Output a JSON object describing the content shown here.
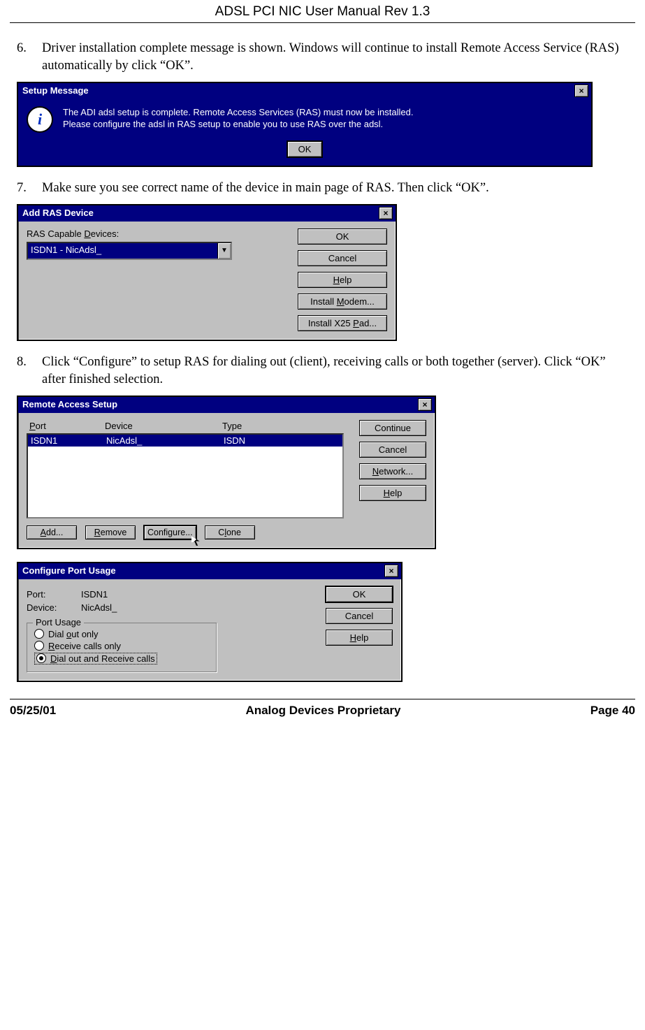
{
  "header": "ADSL PCI NIC User Manual Rev 1.3",
  "footer": {
    "date": "05/25/01",
    "center": "Analog Devices Proprietary",
    "page": "Page 40"
  },
  "steps": {
    "s6": {
      "num": "6.",
      "text": "Driver installation complete message is shown.  Windows will continue to install Remote Access Service (RAS) automatically by click “OK”."
    },
    "s7": {
      "num": "7.",
      "text": "Make sure you see correct name of the device in main page of RAS.  Then click “OK”."
    },
    "s8": {
      "num": "8.",
      "text": "Click “Configure” to setup RAS for dialing out (client), receiving calls or both together (server).  Click “OK” after finished selection."
    }
  },
  "dlg1": {
    "title": "Setup Message",
    "line1": "The ADI adsl setup is complete. Remote Access Services (RAS) must now be installed.",
    "line2": "Please configure the adsl in RAS setup to enable you to use RAS over the adsl.",
    "ok": "OK"
  },
  "dlg2": {
    "title": "Add RAS Device",
    "label": "RAS Capable Devices:",
    "label_underline": "D",
    "selected": "ISDN1 - NicAdsl_",
    "buttons": {
      "ok": "OK",
      "cancel": "Cancel",
      "help": "Help",
      "help_u": "H",
      "modem": "Install Modem...",
      "modem_u": "M",
      "x25": "Install X25 Pad...",
      "x25_u": "P"
    }
  },
  "dlg3": {
    "title": "Remote Access Setup",
    "cols": {
      "port": "Port",
      "port_u": "P",
      "device": "Device",
      "type": "Type"
    },
    "row": {
      "port": "ISDN1",
      "device": "NicAdsl_",
      "type": "ISDN"
    },
    "buttons": {
      "continue": "Continue",
      "cancel": "Cancel",
      "network": "Network...",
      "network_u": "N",
      "help": "Help",
      "help_u": "H",
      "add": "Add...",
      "add_u": "A",
      "remove": "Remove",
      "remove_u": "R",
      "configure": "Configure...",
      "clone": "Clone",
      "clone_u": "l"
    }
  },
  "dlg4": {
    "title": "Configure Port Usage",
    "port_k": "Port:",
    "port_v": "ISDN1",
    "device_k": "Device:",
    "device_v": "NicAdsl_",
    "legend": "Port Usage",
    "r1": "Dial out only",
    "r1_u": "o",
    "r2": "Receive calls only",
    "r2_u": "R",
    "r3": "Dial out and Receive calls",
    "r3_u": "D",
    "buttons": {
      "ok": "OK",
      "cancel": "Cancel",
      "help": "Help",
      "help_u": "H"
    }
  }
}
